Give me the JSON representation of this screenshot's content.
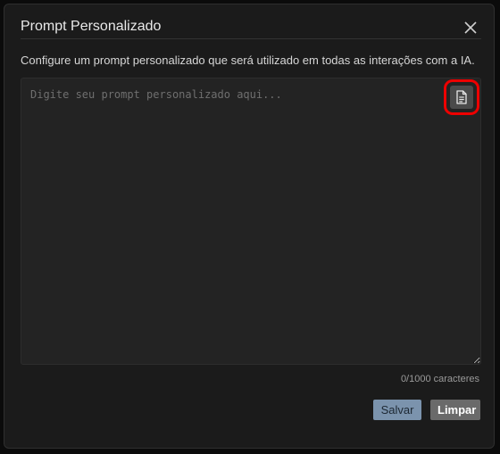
{
  "dialog": {
    "title": "Prompt Personalizado",
    "close_icon": "close-icon",
    "description": "Configure um prompt personalizado que será utilizado em todas as interações com a IA."
  },
  "prompt": {
    "placeholder": "Digite seu prompt personalizado aqui...",
    "value": "",
    "doc_icon": "document-icon",
    "highlight_color": "#ee0000"
  },
  "counter": {
    "text": "0/1000 caracteres"
  },
  "actions": {
    "save_label": "Salvar",
    "clear_label": "Limpar"
  },
  "colors": {
    "dialog_bg": "#1b1b1b",
    "save_bg": "#7b93ad",
    "clear_bg": "#6a6a6a"
  }
}
